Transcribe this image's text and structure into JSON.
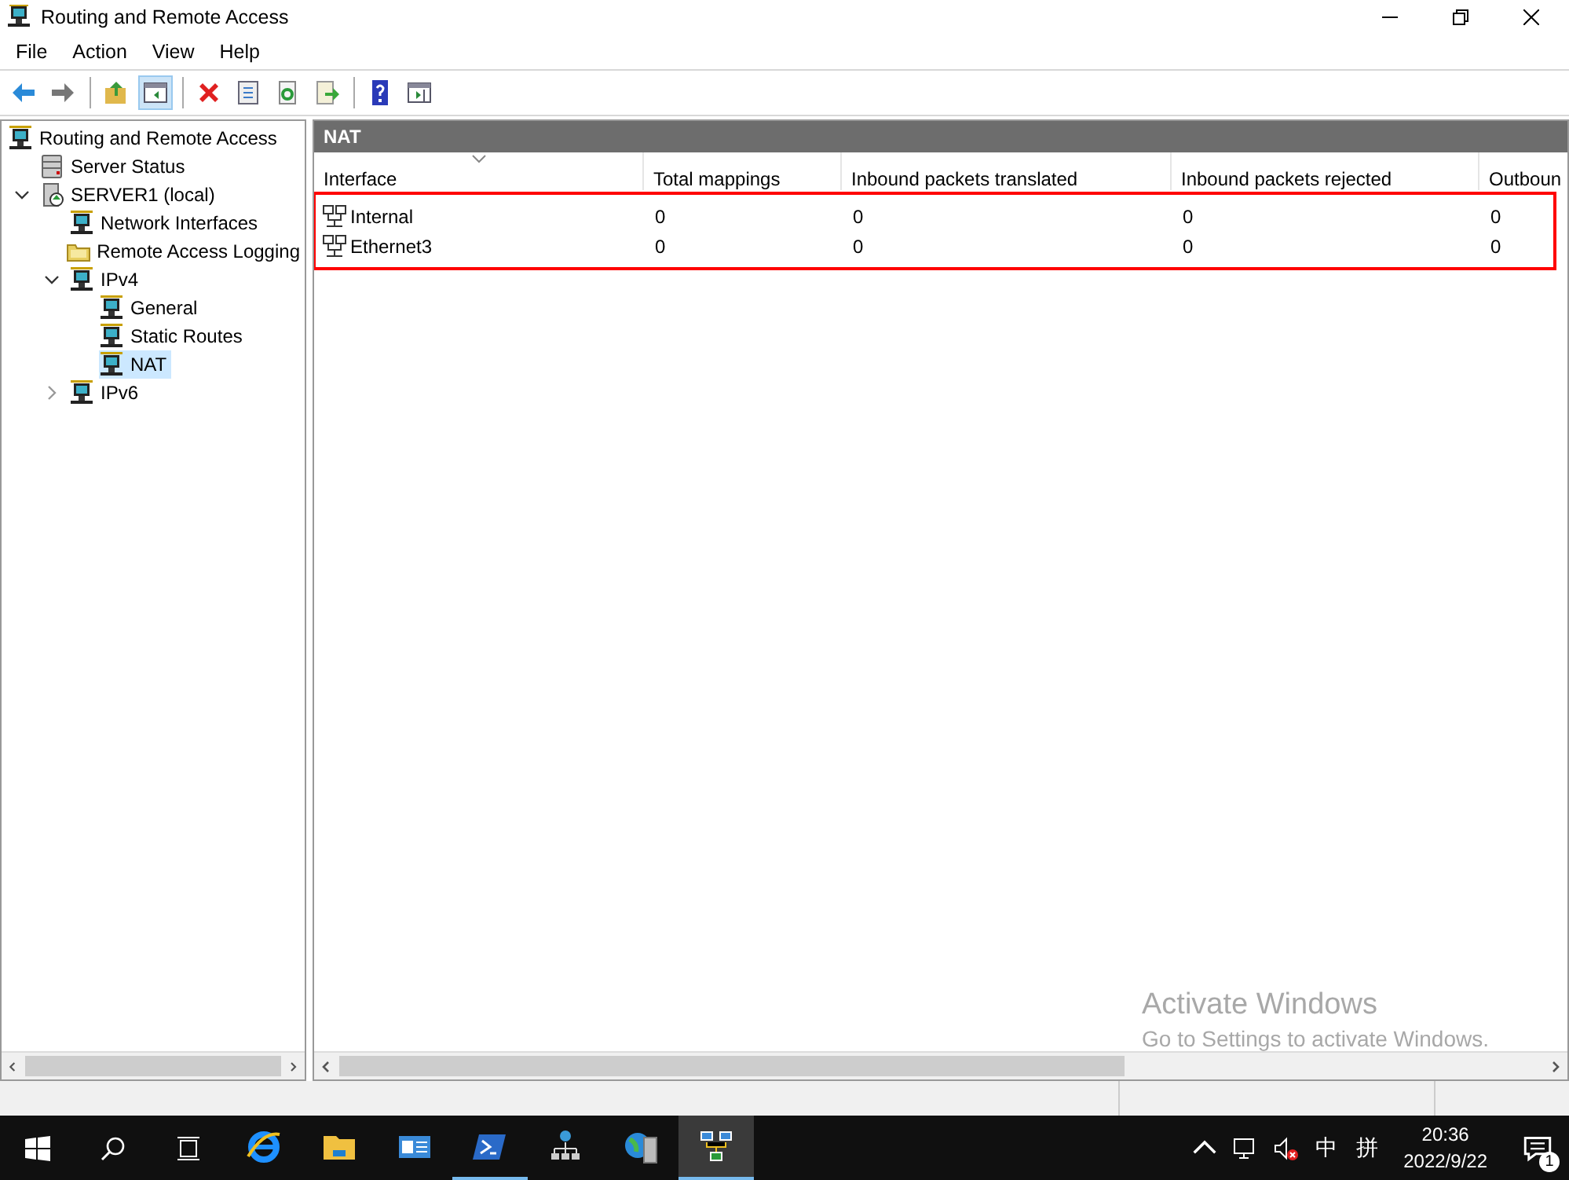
{
  "window": {
    "title": "Routing and Remote Access"
  },
  "menu": [
    "File",
    "Action",
    "View",
    "Help"
  ],
  "toolbar": [
    [
      {
        "kind": "back",
        "pressed": false
      },
      {
        "kind": "forward",
        "pressed": false
      }
    ],
    [
      {
        "kind": "up",
        "pressed": false
      },
      {
        "kind": "tree-toggle",
        "pressed": true
      }
    ],
    [
      {
        "kind": "delete",
        "pressed": false
      },
      {
        "kind": "properties",
        "pressed": false
      },
      {
        "kind": "refresh",
        "pressed": false
      },
      {
        "kind": "export",
        "pressed": false
      }
    ],
    [
      {
        "kind": "help",
        "pressed": false
      },
      {
        "kind": "action-pane",
        "pressed": false
      }
    ]
  ],
  "tree": [
    {
      "label": "Routing and Remote Access",
      "kind": "network",
      "selected": false,
      "children": [
        {
          "label": "Server Status",
          "kind": "servers",
          "selected": false
        },
        {
          "label": "SERVER1 (local)",
          "kind": "server",
          "selected": false,
          "expanded": true,
          "children": [
            {
              "label": "Network Interfaces",
              "kind": "network",
              "selected": false
            },
            {
              "label": "Remote Access Logging",
              "kind": "folder",
              "selected": false
            },
            {
              "label": "IPv4",
              "kind": "network",
              "selected": false,
              "expanded": true,
              "children": [
                {
                  "label": "General",
                  "kind": "network",
                  "selected": false
                },
                {
                  "label": "Static Routes",
                  "kind": "network",
                  "selected": false
                },
                {
                  "label": "NAT",
                  "kind": "network",
                  "selected": true
                }
              ]
            },
            {
              "label": "IPv6",
              "kind": "network",
              "selected": false,
              "expanded": false
            }
          ]
        }
      ]
    }
  ],
  "pane": {
    "title": "NAT"
  },
  "table": {
    "highlighted": true,
    "columns": [
      {
        "label": "Interface",
        "sorted": true
      },
      {
        "label": "Total mappings",
        "sorted": false
      },
      {
        "label": "Inbound packets translated",
        "sorted": false
      },
      {
        "label": "Inbound packets rejected",
        "sorted": false
      },
      {
        "label": "Outboun",
        "sorted": false
      }
    ],
    "rows": [
      {
        "cells": [
          "Internal",
          "0",
          "0",
          "0",
          "0"
        ]
      },
      {
        "cells": [
          "Ethernet3",
          "0",
          "0",
          "0",
          "0"
        ]
      }
    ]
  },
  "activation_notice": {
    "title": "Activate Windows",
    "text": "Go to Settings to activate Windows."
  },
  "taskbar": {
    "apps": [
      {
        "kind": "ie",
        "running": false,
        "selected": false
      },
      {
        "kind": "explorer",
        "running": false,
        "selected": false
      },
      {
        "kind": "server-manager",
        "running": false,
        "selected": false
      },
      {
        "kind": "powershell",
        "running": true,
        "selected": false
      },
      {
        "kind": "network-tool",
        "running": false,
        "selected": false
      },
      {
        "kind": "globe-server",
        "running": false,
        "selected": false
      },
      {
        "kind": "rras",
        "running": true,
        "selected": true
      }
    ],
    "ime": [
      "中",
      "拼"
    ],
    "time": "20:36",
    "date": "2022/9/22",
    "notifications": "1"
  }
}
